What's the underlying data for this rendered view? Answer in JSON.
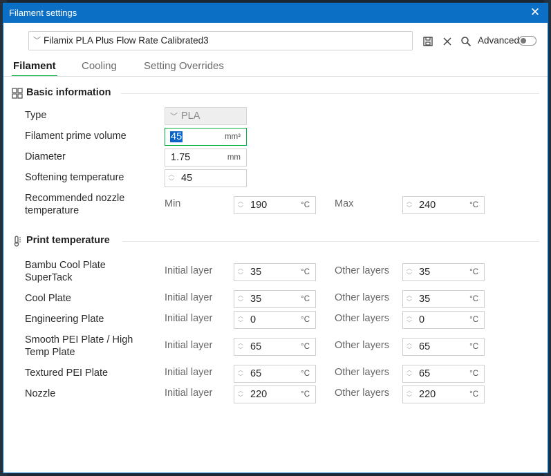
{
  "window": {
    "title": "Filament settings"
  },
  "toolbar": {
    "preset_name": "Filamix PLA Plus Flow Rate Calibrated3",
    "advanced_label": "Advanced"
  },
  "tabs": [
    "Filament",
    "Cooling",
    "Setting Overrides"
  ],
  "basic": {
    "title": "Basic information",
    "type_label": "Type",
    "type_value": "PLA",
    "prime_label": "Filament prime volume",
    "prime_value": "45",
    "prime_unit": "mm³",
    "diameter_label": "Diameter",
    "diameter_value": "1.75",
    "diameter_unit": "mm",
    "soft_label": "Softening temperature",
    "soft_value": "45",
    "nozzle_label": "Recommended nozzle temperature",
    "min_label": "Min",
    "min_value": "190",
    "max_label": "Max",
    "max_value": "240",
    "unit_c": "°C"
  },
  "print": {
    "title": "Print temperature",
    "initial_label": "Initial layer",
    "other_label": "Other layers",
    "rows": [
      {
        "label": "Bambu Cool Plate SuperTack",
        "initial": "35",
        "other": "35"
      },
      {
        "label": "Cool Plate",
        "initial": "35",
        "other": "35"
      },
      {
        "label": "Engineering Plate",
        "initial": "0",
        "other": "0"
      },
      {
        "label": "Smooth PEI Plate / High Temp Plate",
        "initial": "65",
        "other": "65"
      },
      {
        "label": "Textured PEI Plate",
        "initial": "65",
        "other": "65"
      },
      {
        "label": "Nozzle",
        "initial": "220",
        "other": "220"
      }
    ]
  },
  "colors": {
    "accent": "#00ae42",
    "titlebar": "#0b6fc6"
  }
}
